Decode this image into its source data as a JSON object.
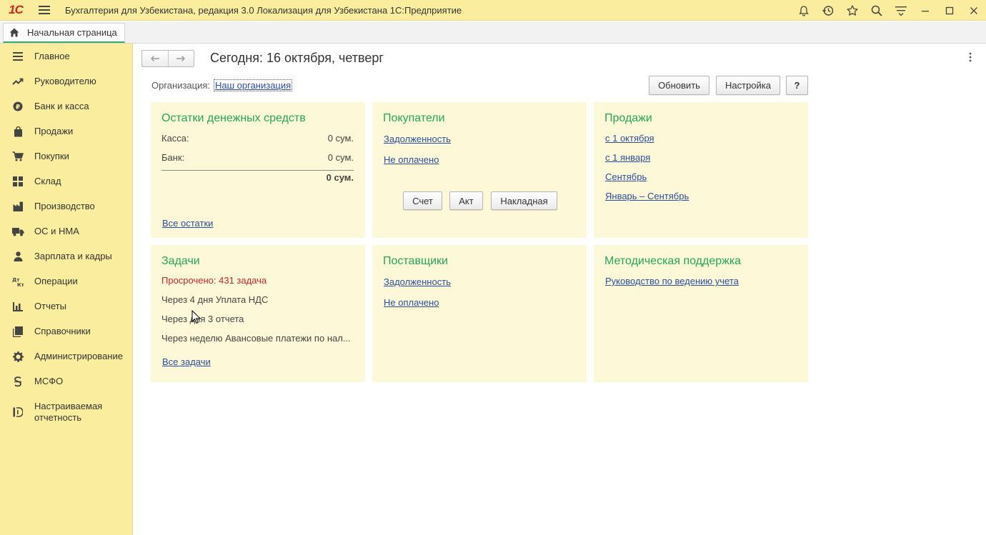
{
  "window": {
    "title": "Бухгалтерия для Узбекистана, редакция 3.0 Локализация для Узбекистана 1С:Предприятие",
    "logo": "1С",
    "icons": [
      "bell-icon",
      "history-icon",
      "star-icon",
      "search-icon",
      "menu-lines-icon",
      "minimize-icon",
      "maximize-icon",
      "close-icon"
    ]
  },
  "tabs": [
    {
      "label": "Начальная страница"
    }
  ],
  "sidebar": {
    "items": [
      {
        "label": "Главное",
        "icon": "list-icon"
      },
      {
        "label": "Руководителю",
        "icon": "trend-icon"
      },
      {
        "label": "Банк и касса",
        "icon": "coin-icon"
      },
      {
        "label": "Продажи",
        "icon": "bag-icon"
      },
      {
        "label": "Покупки",
        "icon": "cart-icon"
      },
      {
        "label": "Склад",
        "icon": "grid-icon"
      },
      {
        "label": "Производство",
        "icon": "factory-icon"
      },
      {
        "label": "ОС и НМА",
        "icon": "truck-icon"
      },
      {
        "label": "Зарплата и кадры",
        "icon": "person-icon"
      },
      {
        "label": "Операции",
        "icon": "debit-credit-icon"
      },
      {
        "label": "Отчеты",
        "icon": "bar-chart-icon"
      },
      {
        "label": "Справочники",
        "icon": "books-icon"
      },
      {
        "label": "Администрирование",
        "icon": "gear-icon"
      },
      {
        "label": "МСФО",
        "icon": "ifrs-icon"
      },
      {
        "label": "Настраиваемая отчетность",
        "icon": "custom-report-icon"
      }
    ]
  },
  "header": {
    "title": "Сегодня: 16 октября, четверг",
    "org_label": "Организация:",
    "org_value": "Наш организация",
    "refresh": "Обновить",
    "settings": "Настройка",
    "help": "?"
  },
  "panels": {
    "cash": {
      "title": "Остатки денежных средств",
      "rows": [
        {
          "label": "Касса:",
          "value": "0 сум."
        },
        {
          "label": "Банк:",
          "value": "0 сум."
        }
      ],
      "total": "0 сум.",
      "link": "Все остатки"
    },
    "buyers": {
      "title": "Покупатели",
      "links": [
        "Задолженность",
        "Не оплачено"
      ],
      "buttons": [
        "Счет",
        "Акт",
        "Накладная"
      ]
    },
    "sales": {
      "title": "Продажи",
      "links": [
        "с 1 октября",
        "с 1 января",
        "Сентябрь",
        "Январь – Сентябрь"
      ]
    },
    "tasks": {
      "title": "Задачи",
      "overdue": "Просрочено: 431 задача",
      "items": [
        "Через 4 дня Уплата НДС",
        "Через дня 3 отчета",
        "Через неделю Авансовые платежи по нал..."
      ],
      "link": "Все задачи"
    },
    "suppliers": {
      "title": "Поставщики",
      "links": [
        "Задолженность",
        "Не оплачено"
      ]
    },
    "support": {
      "title": "Методическая поддержка",
      "links": [
        "Руководство по ведению учета"
      ]
    }
  },
  "colors": {
    "accent_yellow": "#fbed9e",
    "panel_bg": "#fdf8d8",
    "title_green": "#28a45b",
    "link_blue": "#2b4e9a",
    "overdue_red": "#c0282d"
  }
}
